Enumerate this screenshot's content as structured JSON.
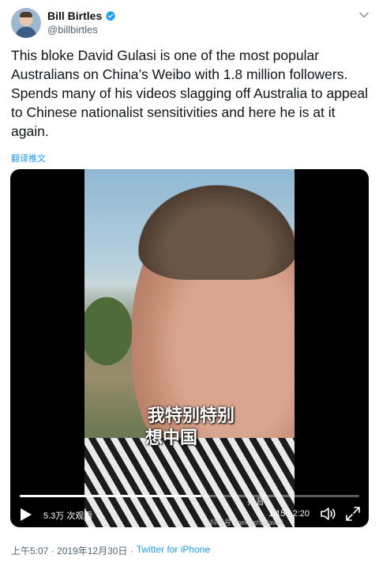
{
  "author": {
    "display_name": "Bill Birtles",
    "handle": "@billbirtles",
    "verified": true
  },
  "tweet": {
    "text": "This bloke David Gulasi is one of the most popular Australians on China’s Weibo with 1.8 million followers. Spends many of his videos slagging off Australia to appeal to Chinese nationalist sensitivities and here he is at it again.",
    "translate_label": "翻译推文"
  },
  "video": {
    "subtitle_line1": "我特别特别",
    "subtitle_line2": "想中国",
    "views": "5.3万 次观看",
    "time": "1:15 / 2:20",
    "progress": 0.535,
    "watermark_brand": "抖音",
    "watermark_id": "抖音号: mengshudawei"
  },
  "meta": {
    "timestamp": "上午5:07 · 2019年12月30日 ·",
    "source": "Twitter for iPhone"
  },
  "icons": {
    "verified": "verified-badge-icon",
    "more": "chevron-down-icon",
    "play": "play-icon",
    "volume": "volume-icon",
    "expand": "expand-icon"
  },
  "colors": {
    "accent": "#1d9bf0",
    "text": "#0f1419",
    "muted": "#536471"
  }
}
